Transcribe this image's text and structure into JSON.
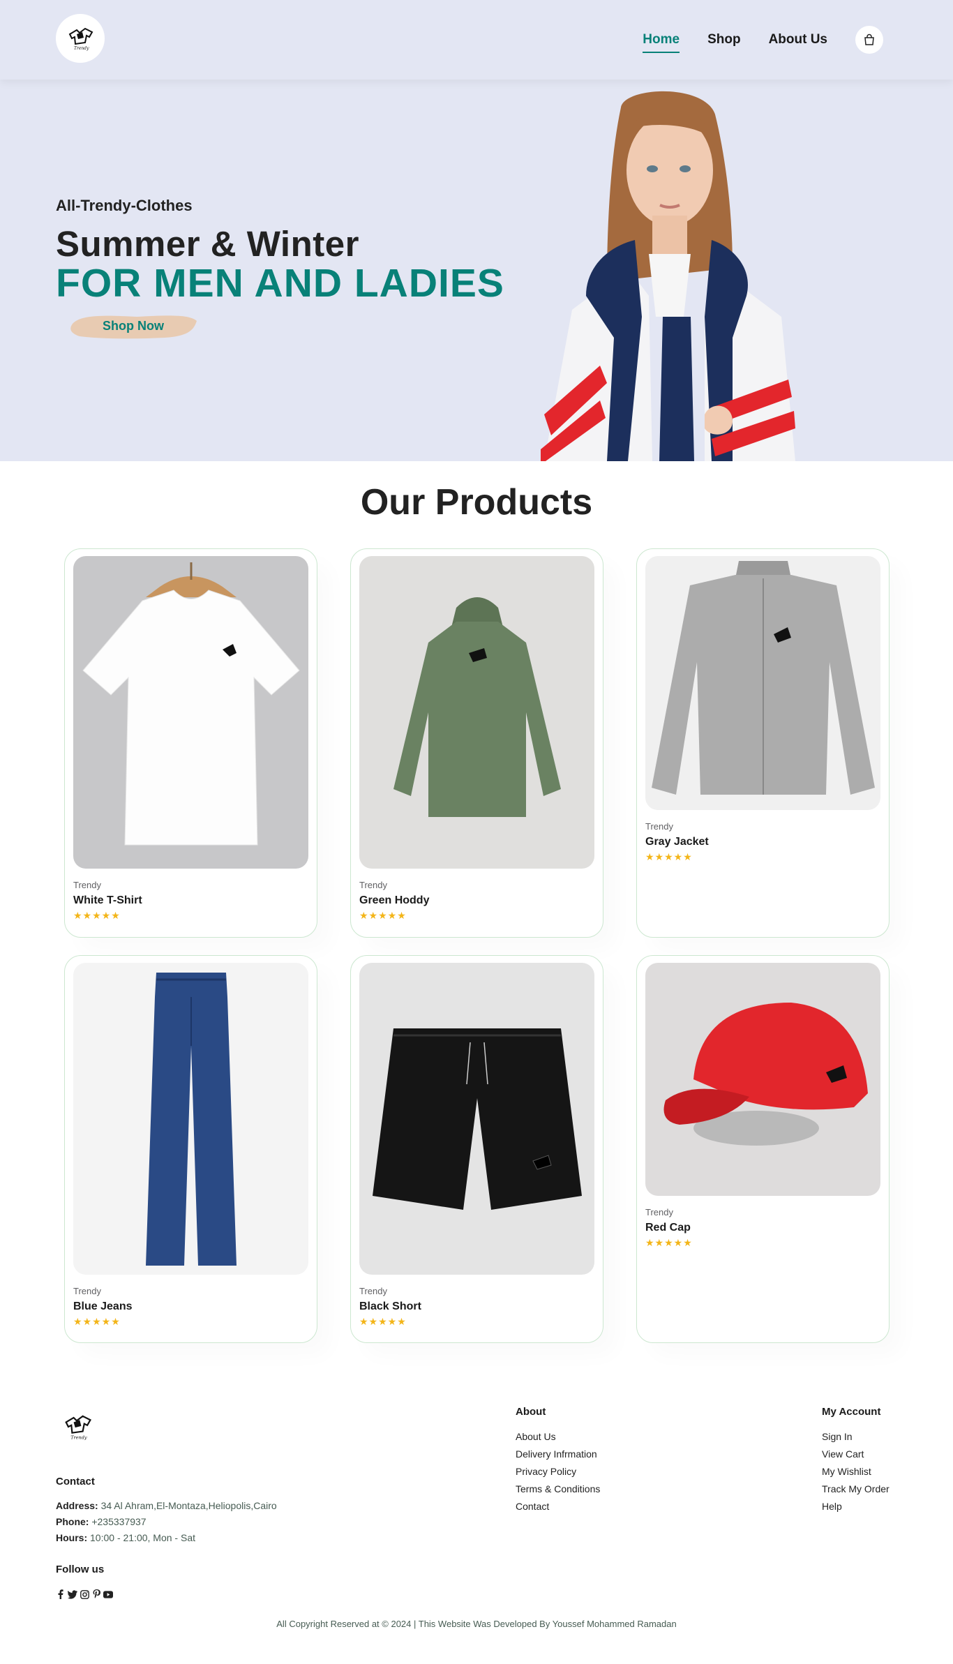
{
  "header": {
    "brand_text": "Trendy",
    "nav": [
      {
        "label": "Home"
      },
      {
        "label": "Shop"
      },
      {
        "label": "About Us"
      }
    ]
  },
  "hero": {
    "subtitle": "All-Trendy-Clothes",
    "title": "Summer & Winter",
    "title2": "FOR MEN AND LADIES",
    "cta": "Shop Now"
  },
  "products": {
    "title": "Our Products",
    "items": [
      {
        "brand": "Trendy",
        "name": "White T-Shirt",
        "stars": "★★★★★"
      },
      {
        "brand": "Trendy",
        "name": "Green Hoddy",
        "stars": "★★★★★"
      },
      {
        "brand": "Trendy",
        "name": "Gray Jacket",
        "stars": "★★★★★"
      },
      {
        "brand": "Trendy",
        "name": "Blue Jeans",
        "stars": "★★★★★"
      },
      {
        "brand": "Trendy",
        "name": "Black Short",
        "stars": "★★★★★"
      },
      {
        "brand": "Trendy",
        "name": "Red Cap",
        "stars": "★★★★★"
      }
    ]
  },
  "footer": {
    "contact": {
      "heading": "Contact",
      "address_label": "Address:",
      "address": " 34 Al Ahram,El-Montaza,Heliopolis,Cairo",
      "phone_label": "Phone:",
      "phone": " +235337937",
      "hours_label": "Hours:",
      "hours": " 10:00 - 21:00, Mon - Sat"
    },
    "follow_heading": "Follow us",
    "about": {
      "heading": "About",
      "links": [
        "About Us",
        "Delivery Infrmation",
        "Privacy Policy",
        "Terms & Conditions",
        "Contact"
      ]
    },
    "account": {
      "heading": "My Account",
      "links": [
        "Sign In",
        "View Cart",
        "My Wishlist",
        "Track My Order",
        "Help"
      ]
    },
    "copyright": "All Copyright Reserved at © 2024 | This Website Was Developed By Youssef Mohammed Ramadan"
  },
  "colors": {
    "accent": "#088178",
    "hero_bg": "#e3e6f3",
    "star": "#f3b519",
    "card_border": "#cce7d0"
  },
  "icons": [
    "shirt-logo-icon",
    "shopping-bag-icon",
    "facebook-icon",
    "twitter-icon",
    "instagram-icon",
    "pinterest-icon",
    "youtube-icon"
  ]
}
